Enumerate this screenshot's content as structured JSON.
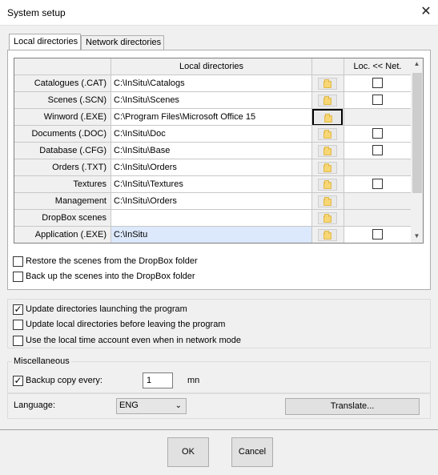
{
  "window": {
    "title": "System setup"
  },
  "tabs": [
    {
      "label": "Local directories",
      "active": true
    },
    {
      "label": "Network directories",
      "active": false
    }
  ],
  "grid": {
    "columns": {
      "local": "Local directories",
      "folder": "",
      "sync": "Loc. << Net."
    },
    "rows": [
      {
        "label": "Catalogues (.CAT)",
        "path": "C:\\InSitu\\Catalogs",
        "has_check": true
      },
      {
        "label": "Scenes (.SCN)",
        "path": "C:\\InSitu\\Scenes",
        "has_check": true
      },
      {
        "label": "Winword (.EXE)",
        "path": "C:\\Program Files\\Microsoft Office 15",
        "has_check": false,
        "focused": true
      },
      {
        "label": "Documents (.DOC)",
        "path": "C:\\InSitu\\Doc",
        "has_check": true
      },
      {
        "label": "Database (.CFG)",
        "path": "C:\\InSitu\\Base",
        "has_check": true
      },
      {
        "label": "Orders (.TXT)",
        "path": "C:\\InSitu\\Orders",
        "has_check": false
      },
      {
        "label": "Textures",
        "path": "C:\\InSitu\\Textures",
        "has_check": true
      },
      {
        "label": "Management",
        "path": "C:\\InSitu\\Orders",
        "has_check": false
      },
      {
        "label": "DropBox scenes",
        "path": "",
        "has_check": false
      },
      {
        "label": "Application (.EXE)",
        "path": "C:\\InSitu",
        "has_check": true,
        "selected": true
      }
    ]
  },
  "dropbox": {
    "restore_label": "Restore the scenes from the DropBox folder",
    "backup_label": "Back up the scenes into the DropBox folder"
  },
  "options": {
    "update_launch": {
      "label": "Update directories launching the program",
      "checked": true
    },
    "update_leave": {
      "label": "Update local directories before leaving the program",
      "checked": false
    },
    "local_time": {
      "label": "Use the local time account even when in network mode",
      "checked": false
    }
  },
  "misc": {
    "group_label": "Miscellaneous",
    "backup_label": "Backup copy every:",
    "backup_checked": true,
    "backup_value": "1",
    "backup_unit": "mn"
  },
  "language": {
    "label": "Language:",
    "value": "ENG",
    "translate_label": "Translate..."
  },
  "buttons": {
    "ok": "OK",
    "cancel": "Cancel"
  },
  "icons": {
    "close": "close-icon",
    "folder": "folder-icon",
    "check": "check-icon",
    "dropdown": "chevron-down-icon"
  }
}
